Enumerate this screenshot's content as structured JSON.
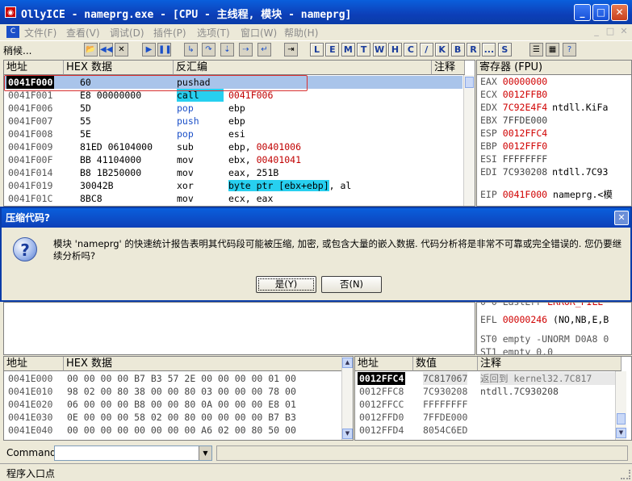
{
  "window": {
    "title": "OllyICE - nameprg.exe - [CPU - 主线程, 模块 - nameprg]",
    "app_icon": "olly-icon",
    "minimize": "_",
    "maximize": "□",
    "close": "✕"
  },
  "menu": {
    "items": [
      "文件(F)",
      "查看(V)",
      "调试(D)",
      "插件(P)",
      "选项(T)",
      "窗口(W)",
      "帮助(H)"
    ],
    "mdi_controls": [
      "_",
      "□",
      "✕"
    ]
  },
  "toolbar": {
    "status_text": "稍候...",
    "icon_buttons": [
      "open",
      "rewind",
      "close",
      "run",
      "pause",
      "step-into",
      "step-over",
      "trace-into",
      "trace-over",
      "execute-till-return",
      "goto"
    ],
    "letter_buttons": [
      "L",
      "E",
      "M",
      "T",
      "W",
      "H",
      "C",
      "/",
      "K",
      "B",
      "R",
      "...",
      "S"
    ],
    "right_icons": [
      "list-icon",
      "grid-icon",
      "help-icon"
    ]
  },
  "disasm": {
    "headers": [
      "地址",
      "HEX 数据",
      "反汇编",
      "注释"
    ],
    "rows": [
      {
        "addr": "0041F000",
        "hex": "60",
        "mnem": "pushad",
        "op": "",
        "selected": true
      },
      {
        "addr": "0041F001",
        "hex": "E8 00000000",
        "mnem": "call",
        "op": "0041F006",
        "mnem_style": "call"
      },
      {
        "addr": "0041F006",
        "hex": "5D",
        "mnem": "pop",
        "op": "ebp",
        "mnem_style": "stack"
      },
      {
        "addr": "0041F007",
        "hex": "55",
        "mnem": "push",
        "op": "ebp",
        "mnem_style": "stack"
      },
      {
        "addr": "0041F008",
        "hex": "5E",
        "mnem": "pop",
        "op": "esi",
        "mnem_style": "stack"
      },
      {
        "addr": "0041F009",
        "hex": "81ED 06104000",
        "mnem": "sub",
        "op": "ebp, ",
        "op_red": "00401006"
      },
      {
        "addr": "0041F00F",
        "hex": "BB 41104000",
        "mnem": "mov",
        "op": "ebx, ",
        "op_red": "00401041"
      },
      {
        "addr": "0041F014",
        "hex": "B8 1B250000",
        "mnem": "mov",
        "op": "eax, 251B"
      },
      {
        "addr": "0041F019",
        "hex": "30042B",
        "mnem": "xor",
        "op_mem": "byte ptr [ebx+ebp]",
        "op": ", al"
      },
      {
        "addr": "0041F01C",
        "hex": "8BC8",
        "mnem": "mov",
        "op": "ecx, eax"
      }
    ]
  },
  "registers": {
    "header": "寄存器 (FPU)",
    "rows": [
      {
        "name": "EAX",
        "value": "00000000",
        "changed": true,
        "note": ""
      },
      {
        "name": "ECX",
        "value": "0012FFB0",
        "changed": true,
        "note": ""
      },
      {
        "name": "EDX",
        "value": "7C92E4F4",
        "changed": true,
        "note": "ntdll.KiFa"
      },
      {
        "name": "EBX",
        "value": "7FFDE000",
        "changed": false,
        "note": ""
      },
      {
        "name": "ESP",
        "value": "0012FFC4",
        "changed": true,
        "note": ""
      },
      {
        "name": "EBP",
        "value": "0012FFF0",
        "changed": true,
        "note": ""
      },
      {
        "name": "ESI",
        "value": "FFFFFFFF",
        "changed": false,
        "note": ""
      },
      {
        "name": "EDI",
        "value": "7C930208",
        "changed": false,
        "note": "ntdll.7C93"
      }
    ],
    "eip": {
      "name": "EIP",
      "value": "0041F000",
      "note": "nameprg.<模"
    },
    "lower_rows": [
      {
        "text": "0 0  LastErr ",
        "red": "ERROR_FILE"
      },
      {
        "text": "EFL ",
        "red": "00000246",
        "note": " (NO,NB,E,B"
      },
      {
        "text": "ST0 empty -UNORM D0A8 0"
      },
      {
        "text": "ST1 empty 0.0"
      }
    ]
  },
  "dump": {
    "headers": [
      "地址",
      "HEX 数据"
    ],
    "rows": [
      {
        "addr": "0041E000",
        "hex": "00 00 00 00 B7 B3 57 2E 00 00 00 00 01 00"
      },
      {
        "addr": "0041E010",
        "hex": "98 02 00 80 38 00 00 80 03 00 00 00 78 00"
      },
      {
        "addr": "0041E020",
        "hex": "06 00 00 00 B8 00 00 80 0A 00 00 00 E8 01"
      },
      {
        "addr": "0041E030",
        "hex": "0E 00 00 00 58 02 00 80 00 00 00 00 B7 B3"
      },
      {
        "addr": "0041E040",
        "hex": "00 00 00 00 00 00 00 00 A6 02 00 80 50 00"
      }
    ]
  },
  "stack": {
    "headers": [
      "地址",
      "数值",
      "注释"
    ],
    "rows": [
      {
        "addr": "0012FFC4",
        "value": "7C817067",
        "note": "返回到 kernel32.7C817",
        "selected": true
      },
      {
        "addr": "0012FFC8",
        "value": "7C930208",
        "note": "ntdll.7C930208"
      },
      {
        "addr": "0012FFCC",
        "value": "FFFFFFFF",
        "note": ""
      },
      {
        "addr": "0012FFD0",
        "value": "7FFDE000",
        "note": ""
      },
      {
        "addr": "0012FFD4",
        "value": "8054C6ED",
        "note": ""
      }
    ]
  },
  "dialog": {
    "title": "压缩代码?",
    "icon": "question-icon",
    "message": "模块 'nameprg' 的快速统计报告表明其代码段可能被压缩, 加密, 或包含大量的嵌入数据. 代码分析将是非常不可靠或完全错误的. 您仍要继续分析吗?",
    "yes_label": "是(Y)",
    "no_label": "否(N)",
    "close": "✕"
  },
  "command": {
    "label": "Command",
    "value": "",
    "dropdown": "▼"
  },
  "status": {
    "text": "程序入口点"
  }
}
